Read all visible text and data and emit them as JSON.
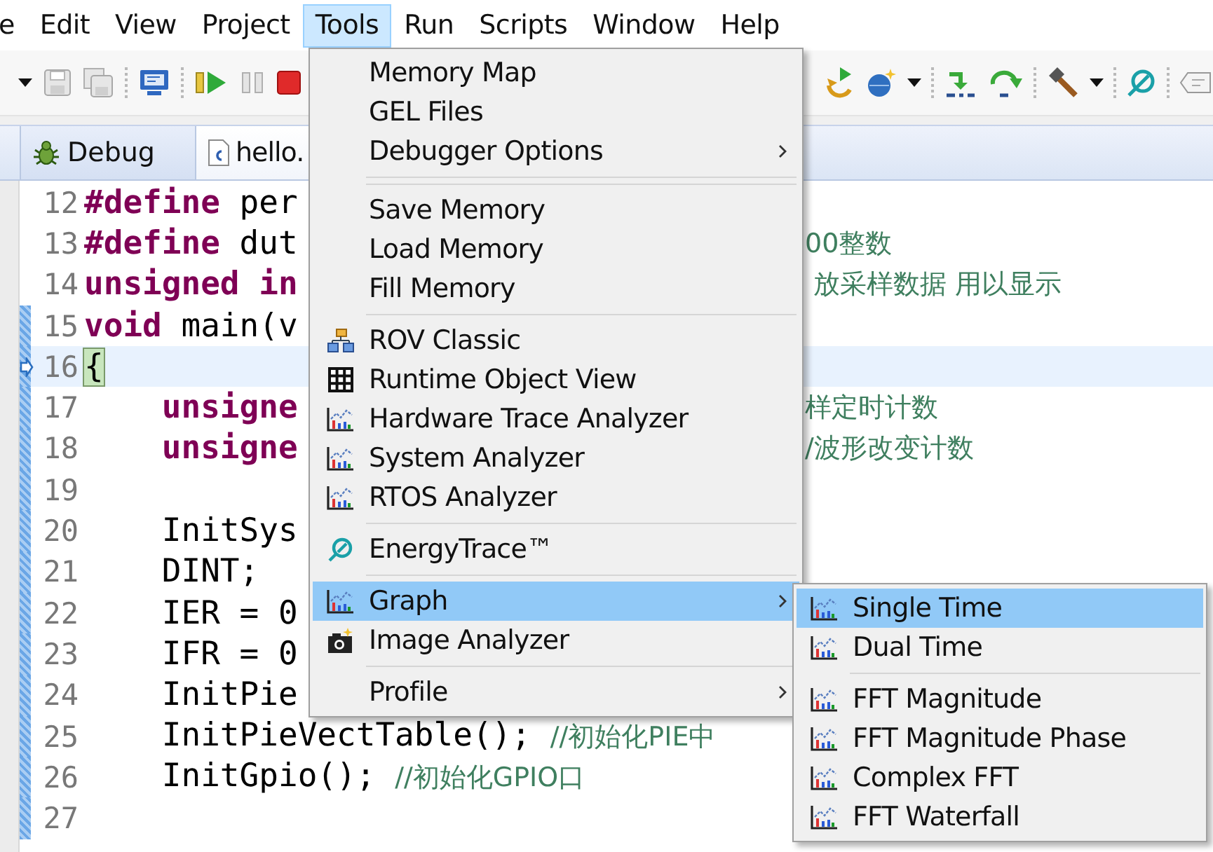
{
  "menubar": [
    {
      "label": "e",
      "selected": false
    },
    {
      "label": "Edit",
      "selected": false
    },
    {
      "label": "View",
      "selected": false
    },
    {
      "label": "Project",
      "selected": false
    },
    {
      "label": "Tools",
      "selected": true
    },
    {
      "label": "Run",
      "selected": false
    },
    {
      "label": "Scripts",
      "selected": false
    },
    {
      "label": "Window",
      "selected": false
    },
    {
      "label": "Help",
      "selected": false
    }
  ],
  "tabs": [
    {
      "label": "Debug",
      "kind": "view"
    },
    {
      "label": "hello.",
      "kind": "file"
    }
  ],
  "editor": {
    "lines": [
      {
        "number": "12",
        "current": false,
        "marked": false,
        "parts": [
          {
            "text": "#define",
            "kind": "keyword"
          },
          {
            "text": " per",
            "kind": "plain"
          }
        ]
      },
      {
        "number": "13",
        "current": false,
        "marked": false,
        "parts": [
          {
            "text": "#define",
            "kind": "keyword"
          },
          {
            "text": " dut",
            "kind": "plain"
          }
        ],
        "tail": [
          {
            "text": "00整数",
            "kind": "comment"
          }
        ]
      },
      {
        "number": "14",
        "current": false,
        "marked": false,
        "parts": [
          {
            "text": "unsigned in",
            "kind": "keyword"
          }
        ],
        "tail": [
          {
            "text": " 放采样数据 用以显示",
            "kind": "comment"
          }
        ]
      },
      {
        "number": "15",
        "current": false,
        "marked": true,
        "parts": [
          {
            "text": "void",
            "kind": "keyword"
          },
          {
            "text": " main(v",
            "kind": "plain"
          }
        ]
      },
      {
        "number": "16",
        "current": true,
        "marked": true,
        "parts": [
          {
            "text": "{",
            "kind": "bracket"
          }
        ]
      },
      {
        "number": "17",
        "current": false,
        "marked": true,
        "parts": [
          {
            "text": "    unsigne",
            "kind": "keyword"
          }
        ],
        "tail": [
          {
            "text": "样定时计数",
            "kind": "comment"
          }
        ]
      },
      {
        "number": "18",
        "current": false,
        "marked": true,
        "parts": [
          {
            "text": "    unsigne",
            "kind": "keyword"
          }
        ],
        "tail": [
          {
            "text": "/波形改变计数",
            "kind": "comment"
          }
        ]
      },
      {
        "number": "19",
        "current": false,
        "marked": true
      },
      {
        "number": "20",
        "current": false,
        "marked": true,
        "parts": [
          {
            "text": "    InitSys",
            "kind": "plain"
          }
        ]
      },
      {
        "number": "21",
        "current": false,
        "marked": true,
        "parts": [
          {
            "text": "    DINT;",
            "kind": "plain"
          }
        ]
      },
      {
        "number": "22",
        "current": false,
        "marked": true,
        "parts": [
          {
            "text": "    IER = 0",
            "kind": "plain"
          }
        ]
      },
      {
        "number": "23",
        "current": false,
        "marked": true,
        "parts": [
          {
            "text": "    IFR = 0",
            "kind": "plain"
          }
        ]
      },
      {
        "number": "24",
        "current": false,
        "marked": true,
        "parts": [
          {
            "text": "    InitPie",
            "kind": "plain"
          }
        ]
      },
      {
        "number": "25",
        "current": false,
        "marked": true,
        "parts": [
          {
            "text": "    InitPieVectTable(); ",
            "kind": "plain"
          },
          {
            "text": "//初始化PIE中",
            "kind": "comment"
          }
        ]
      },
      {
        "number": "26",
        "current": false,
        "marked": true,
        "parts": [
          {
            "text": "    InitGpio(); ",
            "kind": "plain"
          },
          {
            "text": "//初始化GPIO口",
            "kind": "comment"
          }
        ]
      },
      {
        "number": "27",
        "current": false,
        "marked": true
      }
    ]
  },
  "tools_menu": {
    "items": [
      {
        "kind": "item",
        "label": "Memory Map",
        "selected": false,
        "submenu": false
      },
      {
        "kind": "item",
        "label": "GEL Files",
        "selected": false,
        "submenu": false
      },
      {
        "kind": "item",
        "label": "Debugger Options",
        "selected": false,
        "submenu": true
      },
      {
        "kind": "separator"
      },
      {
        "kind": "separator"
      },
      {
        "kind": "item",
        "label": "Save Memory",
        "selected": false,
        "submenu": false
      },
      {
        "kind": "item",
        "label": "Load Memory",
        "selected": false,
        "submenu": false
      },
      {
        "kind": "item",
        "label": "Fill Memory",
        "selected": false,
        "submenu": false
      },
      {
        "kind": "separator"
      },
      {
        "kind": "item",
        "label": "ROV Classic",
        "selected": false,
        "submenu": false
      },
      {
        "kind": "item",
        "label": "Runtime Object View",
        "selected": false,
        "submenu": false
      },
      {
        "kind": "item",
        "label": "Hardware Trace Analyzer",
        "selected": false,
        "submenu": false
      },
      {
        "kind": "item",
        "label": "System Analyzer",
        "selected": false,
        "submenu": false
      },
      {
        "kind": "item",
        "label": "RTOS Analyzer",
        "selected": false,
        "submenu": false
      },
      {
        "kind": "separator"
      },
      {
        "kind": "item",
        "label": "EnergyTrace™",
        "selected": false,
        "submenu": false
      },
      {
        "kind": "separator"
      },
      {
        "kind": "item",
        "label": "Graph",
        "selected": true,
        "submenu": true
      },
      {
        "kind": "item",
        "label": "Image Analyzer",
        "selected": false,
        "submenu": false
      },
      {
        "kind": "separator"
      },
      {
        "kind": "item",
        "label": "Profile",
        "selected": false,
        "submenu": true
      }
    ]
  },
  "graph_submenu": {
    "items": [
      {
        "kind": "item",
        "label": "Single Time",
        "selected": true,
        "submenu": false
      },
      {
        "kind": "item",
        "label": "Dual Time",
        "selected": false,
        "submenu": false
      },
      {
        "kind": "separator"
      },
      {
        "kind": "item",
        "label": "FFT Magnitude",
        "selected": false,
        "submenu": false
      },
      {
        "kind": "item",
        "label": "FFT Magnitude Phase",
        "selected": false,
        "submenu": false
      },
      {
        "kind": "item",
        "label": "Complex FFT",
        "selected": false,
        "submenu": false
      },
      {
        "kind": "item",
        "label": "FFT Waterfall",
        "selected": false,
        "submenu": false
      }
    ]
  }
}
